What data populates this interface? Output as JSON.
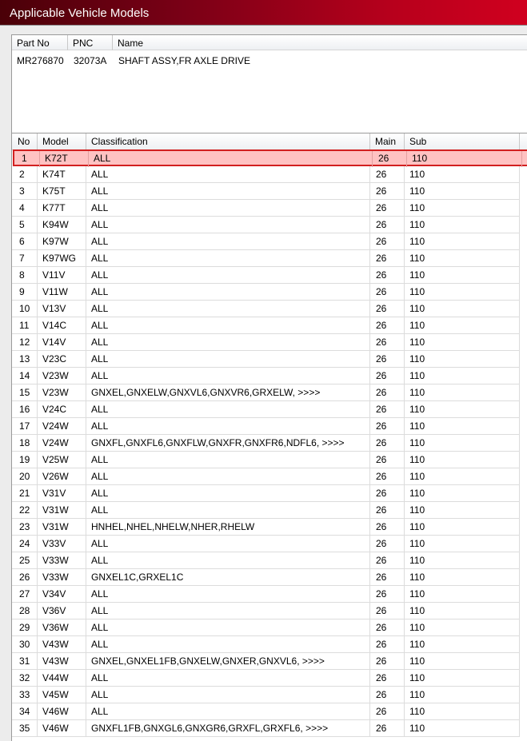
{
  "window": {
    "title": "Applicable Vehicle Models"
  },
  "part": {
    "headers": {
      "part_no": "Part No",
      "pnc": "PNC",
      "name": "Name"
    },
    "values": {
      "part_no": "MR276870",
      "pnc": "32073A",
      "name": "SHAFT ASSY,FR AXLE DRIVE"
    }
  },
  "grid": {
    "headers": {
      "no": "No",
      "model": "Model",
      "classification": "Classification",
      "main": "Main",
      "sub": "Sub"
    },
    "selected_row": 0,
    "rows": [
      {
        "no": "1",
        "model": "K72T",
        "classification": "ALL",
        "main": "26",
        "sub": "110"
      },
      {
        "no": "2",
        "model": "K74T",
        "classification": "ALL",
        "main": "26",
        "sub": "110"
      },
      {
        "no": "3",
        "model": "K75T",
        "classification": "ALL",
        "main": "26",
        "sub": "110"
      },
      {
        "no": "4",
        "model": "K77T",
        "classification": "ALL",
        "main": "26",
        "sub": "110"
      },
      {
        "no": "5",
        "model": "K94W",
        "classification": "ALL",
        "main": "26",
        "sub": "110"
      },
      {
        "no": "6",
        "model": "K97W",
        "classification": "ALL",
        "main": "26",
        "sub": "110"
      },
      {
        "no": "7",
        "model": "K97WG",
        "classification": "ALL",
        "main": "26",
        "sub": "110"
      },
      {
        "no": "8",
        "model": "V11V",
        "classification": "ALL",
        "main": "26",
        "sub": "110"
      },
      {
        "no": "9",
        "model": "V11W",
        "classification": "ALL",
        "main": "26",
        "sub": "110"
      },
      {
        "no": "10",
        "model": "V13V",
        "classification": "ALL",
        "main": "26",
        "sub": "110"
      },
      {
        "no": "11",
        "model": "V14C",
        "classification": "ALL",
        "main": "26",
        "sub": "110"
      },
      {
        "no": "12",
        "model": "V14V",
        "classification": "ALL",
        "main": "26",
        "sub": "110"
      },
      {
        "no": "13",
        "model": "V23C",
        "classification": "ALL",
        "main": "26",
        "sub": "110"
      },
      {
        "no": "14",
        "model": "V23W",
        "classification": "ALL",
        "main": "26",
        "sub": "110"
      },
      {
        "no": "15",
        "model": "V23W",
        "classification": "GNXEL,GNXELW,GNXVL6,GNXVR6,GRXELW,  >>>>",
        "main": "26",
        "sub": "110"
      },
      {
        "no": "16",
        "model": "V24C",
        "classification": "ALL",
        "main": "26",
        "sub": "110"
      },
      {
        "no": "17",
        "model": "V24W",
        "classification": "ALL",
        "main": "26",
        "sub": "110"
      },
      {
        "no": "18",
        "model": "V24W",
        "classification": "GNXFL,GNXFL6,GNXFLW,GNXFR,GNXFR6,NDFL6,  >>>>",
        "main": "26",
        "sub": "110"
      },
      {
        "no": "19",
        "model": "V25W",
        "classification": "ALL",
        "main": "26",
        "sub": "110"
      },
      {
        "no": "20",
        "model": "V26W",
        "classification": "ALL",
        "main": "26",
        "sub": "110"
      },
      {
        "no": "21",
        "model": "V31V",
        "classification": "ALL",
        "main": "26",
        "sub": "110"
      },
      {
        "no": "22",
        "model": "V31W",
        "classification": "ALL",
        "main": "26",
        "sub": "110"
      },
      {
        "no": "23",
        "model": "V31W",
        "classification": "HNHEL,NHEL,NHELW,NHER,RHELW",
        "main": "26",
        "sub": "110"
      },
      {
        "no": "24",
        "model": "V33V",
        "classification": "ALL",
        "main": "26",
        "sub": "110"
      },
      {
        "no": "25",
        "model": "V33W",
        "classification": "ALL",
        "main": "26",
        "sub": "110"
      },
      {
        "no": "26",
        "model": "V33W",
        "classification": "GNXEL1C,GRXEL1C",
        "main": "26",
        "sub": "110"
      },
      {
        "no": "27",
        "model": "V34V",
        "classification": "ALL",
        "main": "26",
        "sub": "110"
      },
      {
        "no": "28",
        "model": "V36V",
        "classification": "ALL",
        "main": "26",
        "sub": "110"
      },
      {
        "no": "29",
        "model": "V36W",
        "classification": "ALL",
        "main": "26",
        "sub": "110"
      },
      {
        "no": "30",
        "model": "V43W",
        "classification": "ALL",
        "main": "26",
        "sub": "110"
      },
      {
        "no": "31",
        "model": "V43W",
        "classification": "GNXEL,GNXEL1FB,GNXELW,GNXER,GNXVL6,  >>>>",
        "main": "26",
        "sub": "110"
      },
      {
        "no": "32",
        "model": "V44W",
        "classification": "ALL",
        "main": "26",
        "sub": "110"
      },
      {
        "no": "33",
        "model": "V45W",
        "classification": "ALL",
        "main": "26",
        "sub": "110"
      },
      {
        "no": "34",
        "model": "V46W",
        "classification": "ALL",
        "main": "26",
        "sub": "110"
      },
      {
        "no": "35",
        "model": "V46W",
        "classification": "GNXFL1FB,GNXGL6,GNXGR6,GRXFL,GRXFL6,  >>>>",
        "main": "26",
        "sub": "110"
      }
    ]
  }
}
